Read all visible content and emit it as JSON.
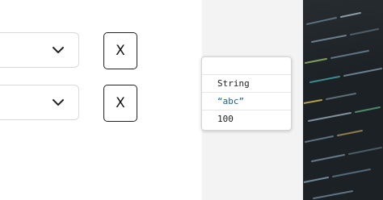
{
  "form": {
    "rows": [
      {
        "remove_label": "X"
      },
      {
        "remove_label": "X"
      }
    ]
  },
  "popover": {
    "items": [
      {
        "label": "String"
      },
      {
        "label": "“abc”"
      },
      {
        "label": "100"
      }
    ]
  },
  "colors": {
    "string_literal": "#1b5fa8",
    "photo_background": "#1c2126"
  },
  "icons": {
    "dropdown": "chevron-down-icon",
    "photo": "code-screen-photo"
  }
}
